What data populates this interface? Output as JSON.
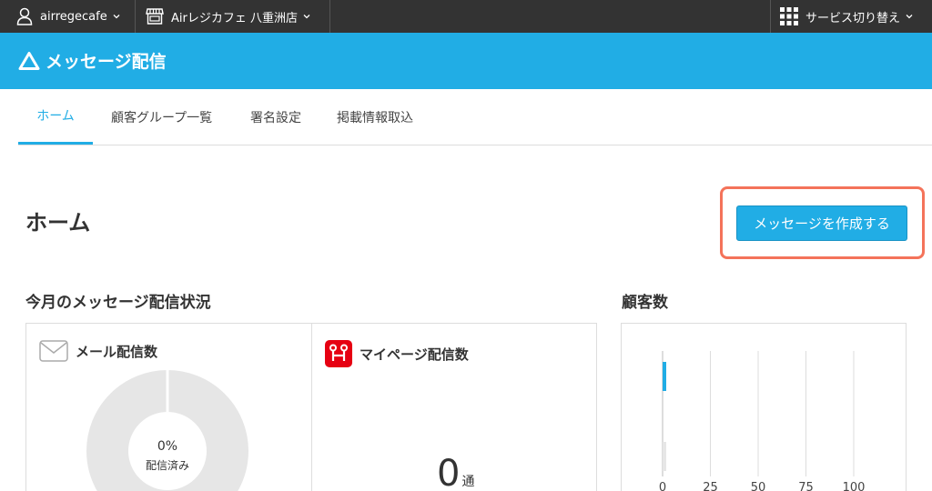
{
  "topbar": {
    "account": "airregecafe",
    "store": "Airレジカフェ 八重洲店",
    "service_switch": "サービス切り替え"
  },
  "header": {
    "app_title": "メッセージ配信"
  },
  "tabs": [
    {
      "label": "ホーム",
      "active": true
    },
    {
      "label": "顧客グループ一覧",
      "active": false
    },
    {
      "label": "署名設定",
      "active": false
    },
    {
      "label": "掲載情報取込",
      "active": false
    }
  ],
  "page": {
    "title": "ホーム",
    "create_button": "メッセージを作成する"
  },
  "status_section": {
    "title": "今月のメッセージ配信状況",
    "mail": {
      "title": "メール配信数",
      "percent": "0%",
      "percent_label": "配信済み"
    },
    "mypage": {
      "title": "マイページ配信数",
      "count": "0",
      "unit": "通"
    }
  },
  "customers_section": {
    "title": "顧客数"
  },
  "chart_data": {
    "type": "bar",
    "orientation": "horizontal",
    "categories": [
      "",
      ""
    ],
    "values": [
      1,
      1
    ],
    "bar_colors": [
      "#21ade5",
      "#e6e6e6"
    ],
    "xlim": [
      0,
      100
    ],
    "x_ticks": [
      "0",
      "25",
      "50",
      "75",
      "100"
    ],
    "grid": true
  },
  "colors": {
    "topbar": "#333333",
    "brand": "#21ade5",
    "highlight": "#f4735a",
    "mypage_icon": "#e60012"
  },
  "icons": {
    "account": "person-icon",
    "store": "store-icon",
    "switch": "grid-icon",
    "mail": "mail-icon",
    "mypage": "mypage-icon",
    "logo": "airregi-logo-icon"
  }
}
